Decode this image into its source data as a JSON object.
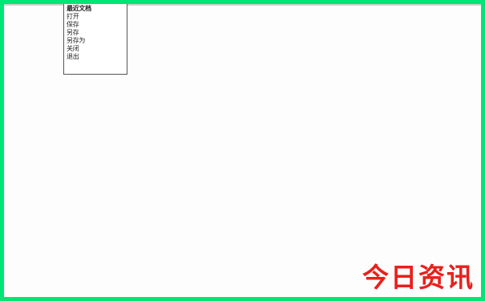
{
  "dropdown": {
    "items": [
      "最近文档",
      "打开",
      "保存",
      "另存",
      "另存为",
      "关闭",
      "退出"
    ]
  },
  "watermark": {
    "text": "今日资讯",
    "color": "#e8201c"
  },
  "frame": {
    "border_color": "#00e676"
  }
}
